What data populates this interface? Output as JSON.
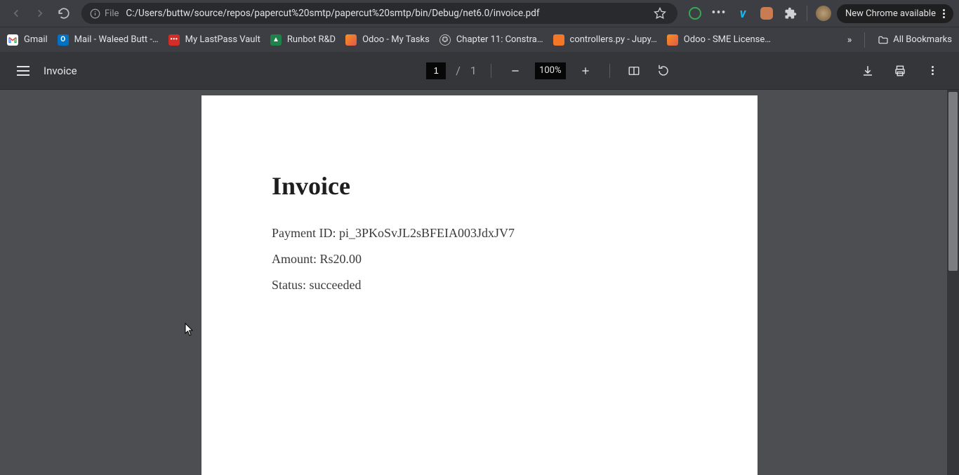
{
  "nav": {
    "scheme_label": "File",
    "url": "C:/Users/buttw/source/repos/papercut%20smtp/papercut%20smtp/bin/Debug/net6.0/invoice.pdf",
    "new_chrome_label": "New Chrome available"
  },
  "bookmarks": [
    {
      "label": "Gmail"
    },
    {
      "label": "Mail - Waleed Butt -…"
    },
    {
      "label": "My LastPass Vault"
    },
    {
      "label": "Runbot R&D"
    },
    {
      "label": "Odoo - My Tasks"
    },
    {
      "label": "Chapter 11: Constra…"
    },
    {
      "label": "controllers.py - Jupy…"
    },
    {
      "label": "Odoo - SME License…"
    }
  ],
  "bookmarks_all_label": "All Bookmarks",
  "pdf": {
    "title": "Invoice",
    "page_current": "1",
    "page_sep": "/",
    "page_total": "1",
    "zoom": "100%"
  },
  "document": {
    "heading": "Invoice",
    "payment_id_label": "Payment ID:",
    "payment_id": "pi_3PKoSvJL2sBFEIA003JdxJV7",
    "amount_label": "Amount:",
    "amount": "Rs20.00",
    "status_label": "Status:",
    "status": "succeeded"
  }
}
